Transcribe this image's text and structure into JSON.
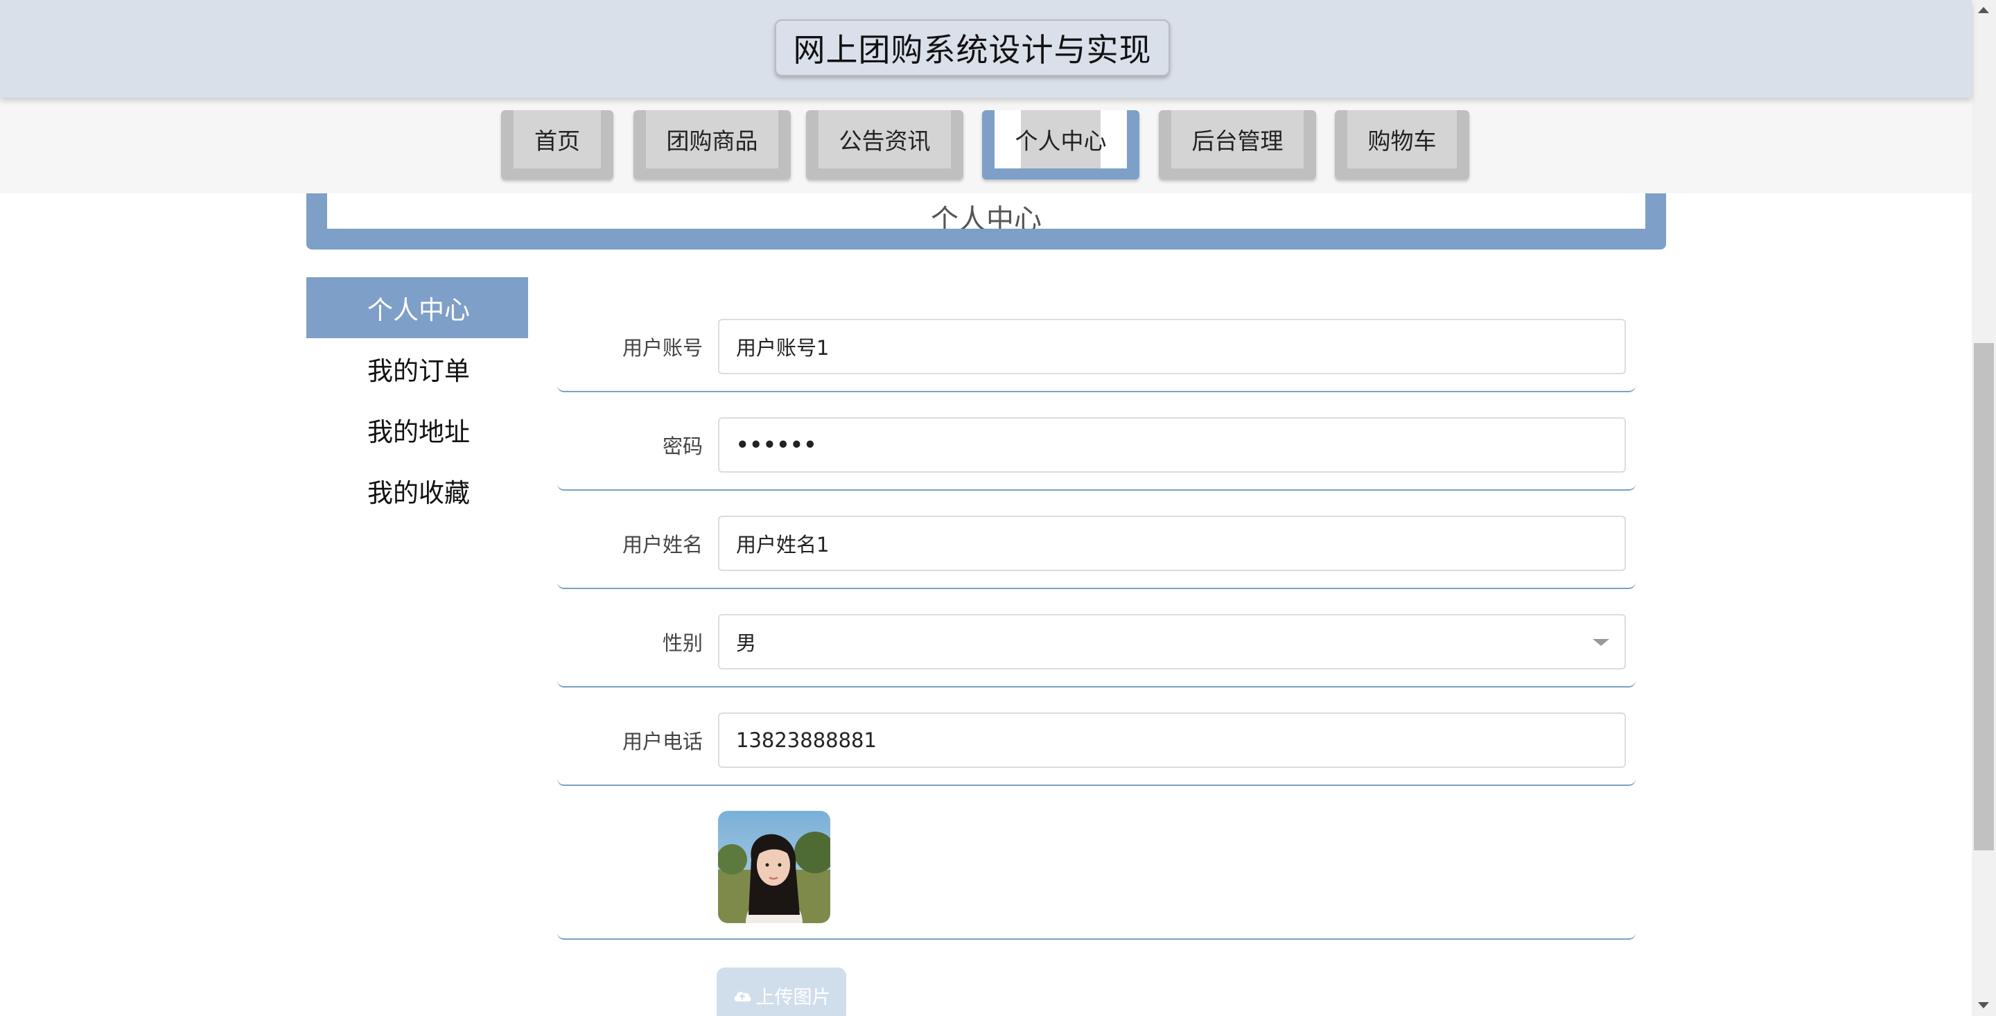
{
  "site": {
    "title": "网上团购系统设计与实现"
  },
  "nav": [
    {
      "label": "首页"
    },
    {
      "label": "团购商品"
    },
    {
      "label": "公告资讯"
    },
    {
      "label": "个人中心"
    },
    {
      "label": "后台管理"
    },
    {
      "label": "购物车"
    }
  ],
  "banner": {
    "title": "个人中心"
  },
  "side_menu": [
    {
      "label": "个人中心"
    },
    {
      "label": "我的订单"
    },
    {
      "label": "我的地址"
    },
    {
      "label": "我的收藏"
    }
  ],
  "form": {
    "account": {
      "label": "用户账号",
      "value": "用户账号1"
    },
    "password": {
      "label": "密码",
      "value": "••••••"
    },
    "name": {
      "label": "用户姓名",
      "value": "用户姓名1"
    },
    "gender": {
      "label": "性别",
      "value": "男"
    },
    "phone": {
      "label": "用户电话",
      "value": "13823888881"
    },
    "upload_label": "上传图片"
  },
  "colors": {
    "accent": "#7e9fc7",
    "header_bg": "#d9e0ea",
    "nav_bg": "#f6f6f6",
    "upload_button": "#d0deec"
  }
}
